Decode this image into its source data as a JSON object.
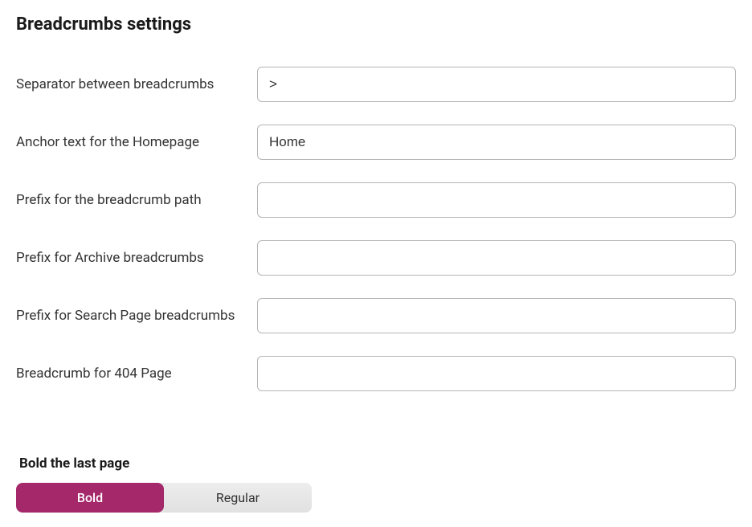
{
  "heading": "Breadcrumbs settings",
  "fields": {
    "separator": {
      "label": "Separator between breadcrumbs",
      "value": ">"
    },
    "anchor_home": {
      "label": "Anchor text for the Homepage",
      "value": "Home"
    },
    "prefix_path": {
      "label": "Prefix for the breadcrumb path",
      "value": ""
    },
    "prefix_archive": {
      "label": "Prefix for Archive breadcrumbs",
      "value": ""
    },
    "prefix_search": {
      "label": "Prefix for Search Page breadcrumbs",
      "value": ""
    },
    "breadcrumb_404": {
      "label": "Breadcrumb for 404 Page",
      "value": ""
    }
  },
  "bold_section": {
    "label": "Bold the last page",
    "options": {
      "bold": "Bold",
      "regular": "Regular"
    },
    "selected": "bold"
  }
}
